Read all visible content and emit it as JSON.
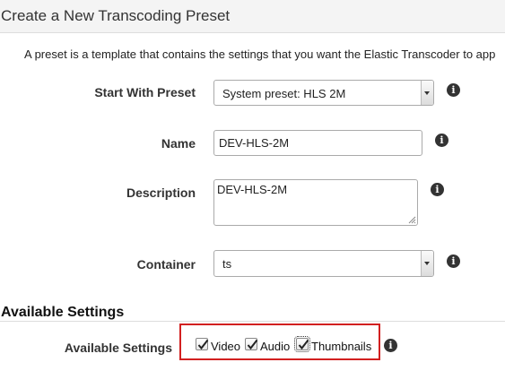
{
  "header": {
    "title": "Create a New Transcoding Preset"
  },
  "intro": {
    "text": "A preset is a template that contains the settings that you want the Elastic Transcoder to app"
  },
  "form": {
    "start_with_preset": {
      "label": "Start With Preset",
      "value": "System preset: HLS 2M"
    },
    "name": {
      "label": "Name",
      "value": "DEV-HLS-2M"
    },
    "description": {
      "label": "Description",
      "value": "DEV-HLS-2M"
    },
    "container": {
      "label": "Container",
      "value": "ts"
    }
  },
  "available_settings": {
    "section_title": "Available Settings",
    "label": "Available Settings",
    "options": [
      {
        "label": "Video",
        "checked": true
      },
      {
        "label": "Audio",
        "checked": true
      },
      {
        "label": "Thumbnails",
        "checked": true
      }
    ]
  },
  "icons": {
    "info": "info-icon",
    "info_glyph": "i",
    "dropdown": "chevron-down-icon",
    "checkmark": "checkmark-icon"
  },
  "colors": {
    "highlight_border": "#d22020",
    "header_bg": "#f4f4f4"
  }
}
